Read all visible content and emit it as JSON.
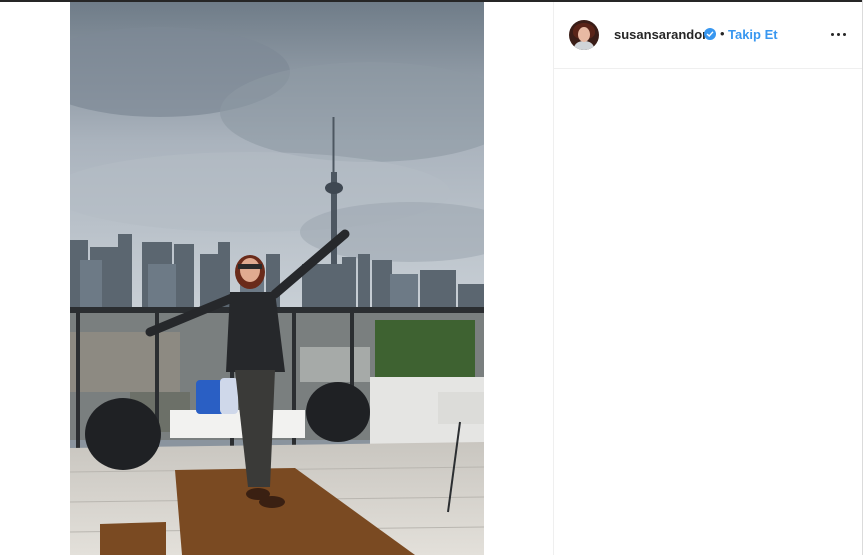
{
  "post": {
    "username": "susansarandon",
    "separator": "•",
    "follow_label": "Takip Et"
  },
  "icons": {
    "verified": "verified-badge-icon",
    "more": "more-options-icon"
  },
  "colors": {
    "follow_blue": "#3897f0",
    "text_dark": "#262626",
    "border": "#efefef"
  }
}
